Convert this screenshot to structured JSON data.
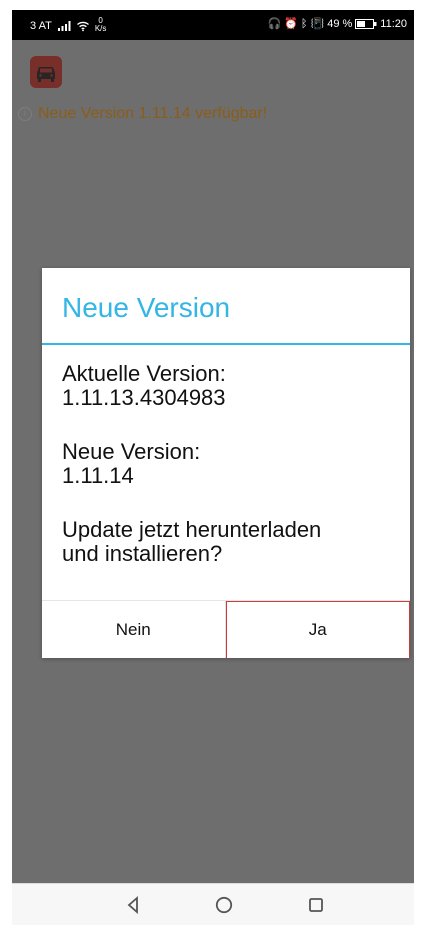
{
  "status_bar": {
    "carrier": "3 AT",
    "speed_value": "0",
    "speed_unit": "K/s",
    "battery_percent": "49 %",
    "time": "11:20",
    "icons": [
      "headset-icon",
      "alarm-icon",
      "bluetooth-icon",
      "vibrate-icon",
      "battery-icon"
    ]
  },
  "app": {
    "icon": "car-icon",
    "banner_icon": "info-icon",
    "banner_text": "Neue Version 1.11.14 verfügbar!"
  },
  "dialog": {
    "title": "Neue Version",
    "current_label": "Aktuelle Version:",
    "current_value": "1.11.13.4304983",
    "new_label": "Neue Version:",
    "new_value": "1.11.14",
    "question_line_1": "Update jetzt herunterladen",
    "question_line_2": "und installieren?",
    "buttons": {
      "no": "Nein",
      "yes": "Ja"
    }
  },
  "navigation": {
    "back_icon": "back-icon",
    "home_icon": "home-icon",
    "recents_icon": "recents-icon"
  },
  "colors": {
    "accent": "#33b5e5",
    "banner_text": "#8a5d1b",
    "overlay": "#6e6e6e",
    "yes_outline": "#cf3b3b"
  }
}
